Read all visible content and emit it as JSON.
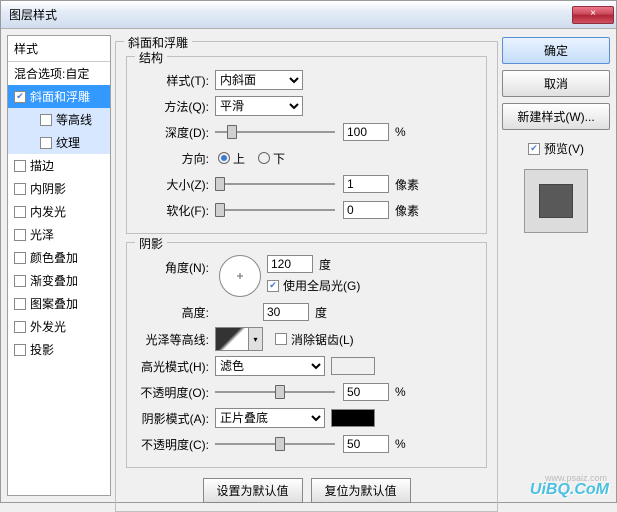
{
  "window": {
    "title": "图层样式",
    "close": "×"
  },
  "sidebar": {
    "header": "样式",
    "blend": "混合选项:自定",
    "items": [
      {
        "label": "斜面和浮雕",
        "checked": true,
        "selected": true
      },
      {
        "label": "等高线",
        "checked": false,
        "sub": true
      },
      {
        "label": "纹理",
        "checked": false,
        "sub": true
      },
      {
        "label": "描边",
        "checked": false
      },
      {
        "label": "内阴影",
        "checked": false
      },
      {
        "label": "内发光",
        "checked": false
      },
      {
        "label": "光泽",
        "checked": false
      },
      {
        "label": "颜色叠加",
        "checked": false
      },
      {
        "label": "渐变叠加",
        "checked": false
      },
      {
        "label": "图案叠加",
        "checked": false
      },
      {
        "label": "外发光",
        "checked": false
      },
      {
        "label": "投影",
        "checked": false
      }
    ]
  },
  "main": {
    "title": "斜面和浮雕",
    "structure": {
      "group": "结构",
      "style_lbl": "样式(T):",
      "style_val": "内斜面",
      "method_lbl": "方法(Q):",
      "method_val": "平滑",
      "depth_lbl": "深度(D):",
      "depth_val": "100",
      "depth_unit": "%",
      "dir_lbl": "方向:",
      "dir_up": "上",
      "dir_down": "下",
      "size_lbl": "大小(Z):",
      "size_val": "1",
      "size_unit": "像素",
      "soften_lbl": "软化(F):",
      "soften_val": "0",
      "soften_unit": "像素"
    },
    "shading": {
      "group": "阴影",
      "angle_lbl": "角度(N):",
      "angle_val": "120",
      "angle_unit": "度",
      "global_lbl": "使用全局光(G)",
      "altitude_lbl": "高度:",
      "altitude_val": "30",
      "altitude_unit": "度",
      "contour_lbl": "光泽等高线:",
      "anti_lbl": "消除锯齿(L)",
      "hilite_mode_lbl": "高光模式(H):",
      "hilite_mode_val": "滤色",
      "hilite_color": "#ffffff",
      "hilite_op_lbl": "不透明度(O):",
      "hilite_op_val": "50",
      "hilite_op_unit": "%",
      "shadow_mode_lbl": "阴影模式(A):",
      "shadow_mode_val": "正片叠底",
      "shadow_color": "#000000",
      "shadow_op_lbl": "不透明度(C):",
      "shadow_op_val": "50",
      "shadow_op_unit": "%"
    },
    "defaults": {
      "set": "设置为默认值",
      "reset": "复位为默认值"
    }
  },
  "right": {
    "ok": "确定",
    "cancel": "取消",
    "new_style": "新建样式(W)...",
    "preview": "预览(V)"
  },
  "watermark": "UiBQ.CoM",
  "watermark2": "www.psaiz.com"
}
